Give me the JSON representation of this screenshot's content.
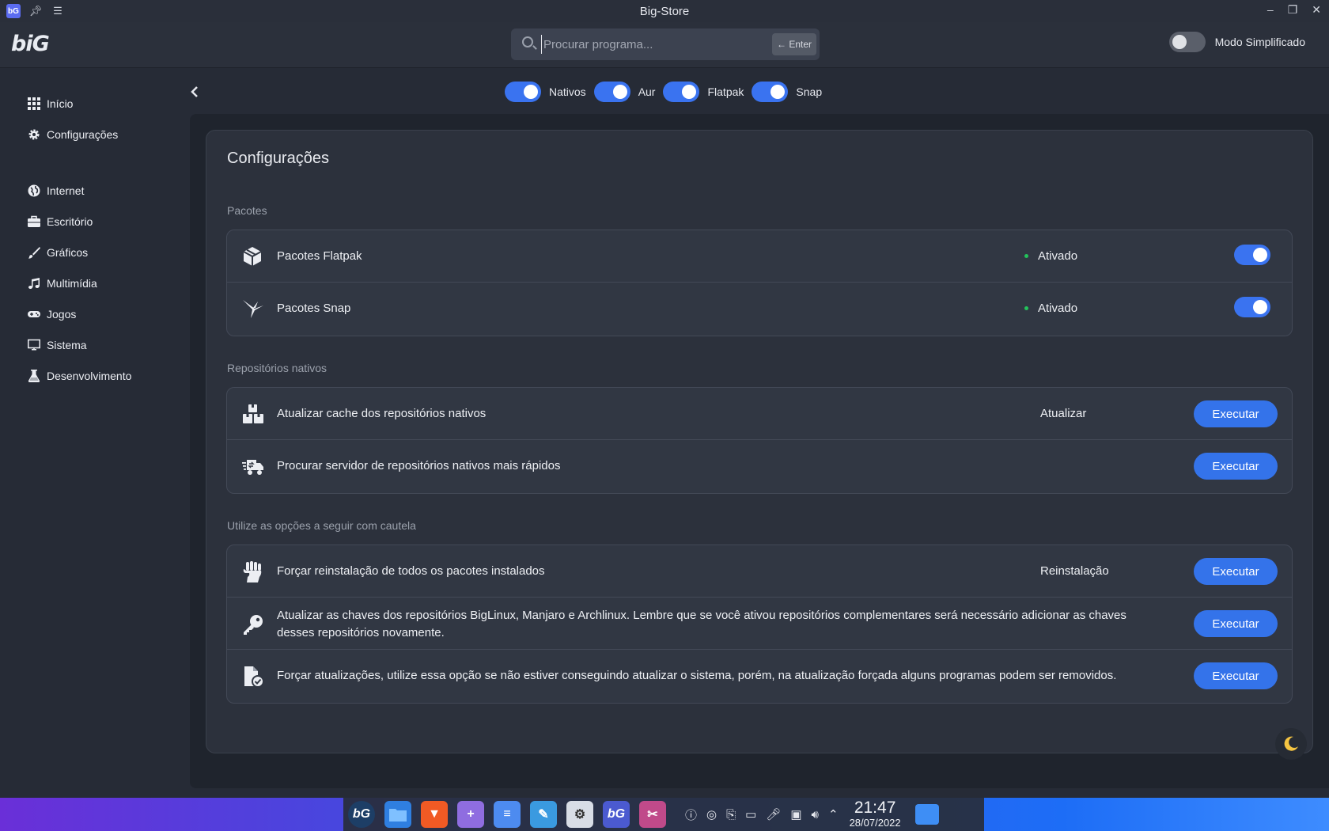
{
  "window": {
    "title": "Big-Store"
  },
  "header": {
    "logo": "biG",
    "search_placeholder": "Procurar programa...",
    "enter_label": "← Enter",
    "simple_mode_label": "Modo Simplificado"
  },
  "sidebar": {
    "items": [
      {
        "label": "Início",
        "icon": "grid-icon"
      },
      {
        "label": "Configurações",
        "icon": "gear-icon"
      },
      {
        "label": "Internet",
        "icon": "globe-icon"
      },
      {
        "label": "Escritório",
        "icon": "briefcase-icon"
      },
      {
        "label": "Gráficos",
        "icon": "brush-icon"
      },
      {
        "label": "Multimídia",
        "icon": "music-icon"
      },
      {
        "label": "Jogos",
        "icon": "gamepad-icon"
      },
      {
        "label": "Sistema",
        "icon": "monitor-icon"
      },
      {
        "label": "Desenvolvimento",
        "icon": "flask-icon"
      }
    ]
  },
  "filters": [
    {
      "label": "Nativos",
      "on": true
    },
    {
      "label": "Aur",
      "on": true
    },
    {
      "label": "Flatpak",
      "on": true
    },
    {
      "label": "Snap",
      "on": true
    }
  ],
  "page": {
    "title": "Configurações",
    "sections": [
      {
        "label": "Pacotes",
        "rows": [
          {
            "label": "Pacotes Flatpak",
            "status": "Ativado",
            "icon": "package-icon"
          },
          {
            "label": "Pacotes Snap",
            "status": "Ativado",
            "icon": "snap-bird-icon"
          }
        ]
      },
      {
        "label": "Repositórios nativos",
        "rows": [
          {
            "label": "Atualizar cache dos repositórios nativos",
            "status": "Atualizar",
            "action": "Executar",
            "icon": "boxes-icon"
          },
          {
            "label": "Procurar servidor de repositórios nativos mais rápidos",
            "action": "Executar",
            "icon": "truck-icon"
          }
        ]
      },
      {
        "label": "Utilize as opções a seguir com cautela",
        "rows": [
          {
            "label": "Forçar reinstalação de todos os pacotes instalados",
            "status": "Reinstalação",
            "action": "Executar",
            "icon": "fist-icon"
          },
          {
            "label": "Atualizar as chaves dos repositórios BigLinux, Manjaro e Archlinux. Lembre que se você ativou repositórios complementares será necessário adicionar as chaves desses repositórios novamente.",
            "action": "Executar",
            "icon": "key-icon"
          },
          {
            "label": "Forçar atualizações, utilize essa opção se não estiver conseguindo atualizar o sistema, porém, na atualização forçada alguns programas podem ser removidos.",
            "action": "Executar",
            "icon": "file-check-icon"
          }
        ]
      }
    ]
  },
  "taskbar": {
    "time": "21:47",
    "date": "28/07/2022"
  },
  "colors": {
    "accent": "#3473ea",
    "status_ok": "#23c35b",
    "bg": "#262b36"
  }
}
